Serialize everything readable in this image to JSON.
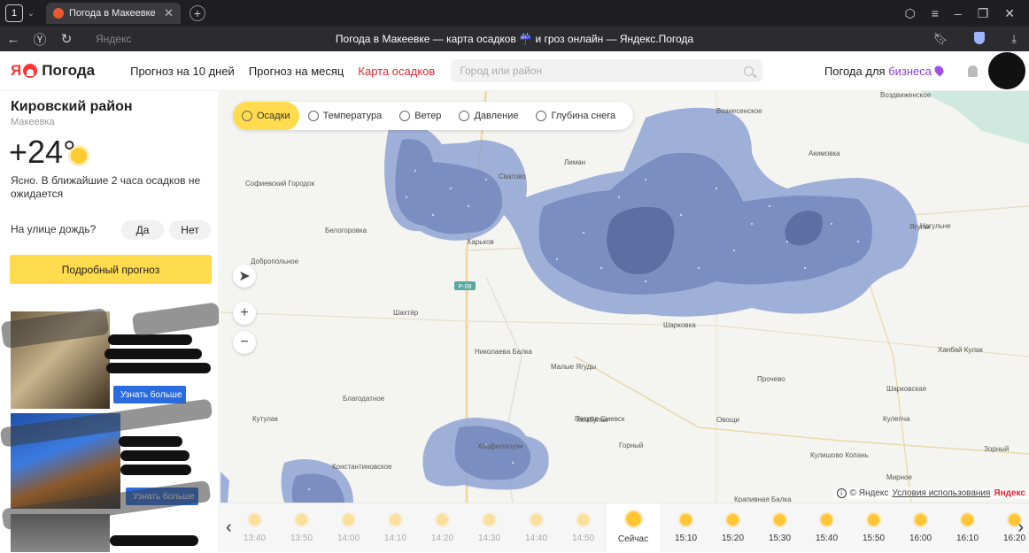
{
  "browser": {
    "tab_count": "1",
    "tab_title": "Погода в Макеевке — ",
    "address_domain": "Яндекс",
    "address_title": "Погода в Макеевке — карта осадков ☔ и гроз онлайн — Яндекс.Погода"
  },
  "header": {
    "logo_ya": "Я",
    "logo_text": "Погода",
    "menu": [
      "Прогноз на 10 дней",
      "Прогноз на месяц",
      "Карта осадков"
    ],
    "search_placeholder": "Город или район",
    "business_prefix": "Погода для ",
    "business_word": "бизнеса"
  },
  "sidebar": {
    "district": "Кировский район",
    "city": "Макеевка",
    "temperature": "+24°",
    "description": "Ясно. В ближайшие 2 часа осадков не ожидается",
    "rain_question": "На улице дождь?",
    "yes": "Да",
    "no": "Нет",
    "forecast_button": "Подробный прогноз",
    "ad_button": "Узнать больше"
  },
  "map": {
    "layers": [
      "Осадки",
      "Температура",
      "Ветер",
      "Давление",
      "Глубина снега"
    ],
    "zoom_in": "+",
    "zoom_out": "−",
    "road_label": "P-08",
    "labels": [
      "Вознесенское",
      "Воздвиженское",
      "Лиман",
      "Сватово",
      "Акимовка",
      "Софиевский Городок",
      "Белогоровка",
      "Харьков",
      "Добропольное",
      "Шахтёр",
      "Нагульне",
      "Шарковка",
      "Николаева Балка",
      "Малые Ягуды",
      "Прочево",
      "Петров Смевск",
      "Благодатное",
      "Кутулак",
      "Кембулак",
      "Овощи",
      "Горный",
      "Кулишово Копань",
      "Ханбай Кулак",
      "Шарковская",
      "Кулепча",
      "Константиновское",
      "Мирное",
      "Зорный",
      "Хоцфиллоуэн",
      "Ягулы",
      "Крапивная Балка"
    ],
    "copyright_text": "© Яндекс",
    "terms_link": "Условия использования",
    "yandex_mark": "Яндекс"
  },
  "timeline": {
    "slots": [
      {
        "time": "13:40",
        "state": "past"
      },
      {
        "time": "13:50",
        "state": "past"
      },
      {
        "time": "14:00",
        "state": "past"
      },
      {
        "time": "14:10",
        "state": "past"
      },
      {
        "time": "14:20",
        "state": "past"
      },
      {
        "time": "14:30",
        "state": "past"
      },
      {
        "time": "14:40",
        "state": "past"
      },
      {
        "time": "14:50",
        "state": "past"
      },
      {
        "time": "Сейчас",
        "state": "now"
      },
      {
        "time": "15:10",
        "state": "future"
      },
      {
        "time": "15:20",
        "state": "future"
      },
      {
        "time": "15:30",
        "state": "future"
      },
      {
        "time": "15:40",
        "state": "future"
      },
      {
        "time": "15:50",
        "state": "future"
      },
      {
        "time": "16:00",
        "state": "future"
      },
      {
        "time": "16:10",
        "state": "future"
      },
      {
        "time": "16:20",
        "state": "future"
      }
    ]
  },
  "colors": {
    "accent_yellow": "#ffdb4d",
    "brand_red": "#e3262f",
    "precip_light": "#8fa3d3",
    "precip_mid": "#6b80b8",
    "precip_dark": "#4d5f96"
  }
}
